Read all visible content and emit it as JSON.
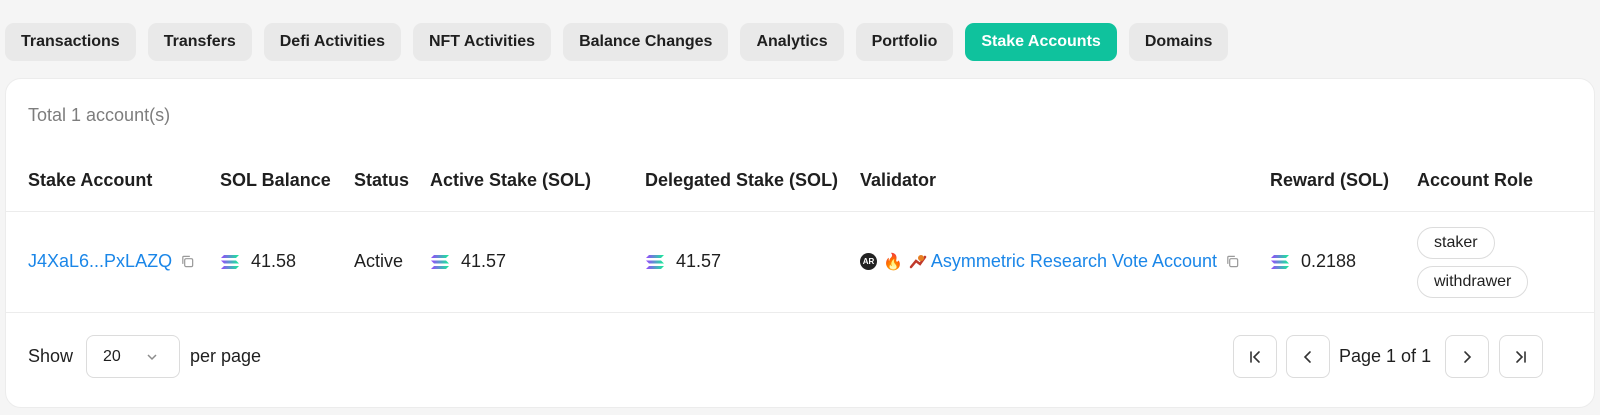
{
  "tabs": [
    {
      "label": "Transactions",
      "active": false
    },
    {
      "label": "Transfers",
      "active": false
    },
    {
      "label": "Defi Activities",
      "active": false
    },
    {
      "label": "NFT Activities",
      "active": false
    },
    {
      "label": "Balance Changes",
      "active": false
    },
    {
      "label": "Analytics",
      "active": false
    },
    {
      "label": "Portfolio",
      "active": false
    },
    {
      "label": "Stake Accounts",
      "active": true
    },
    {
      "label": "Domains",
      "active": false
    }
  ],
  "summary": {
    "total_text": "Total 1 account(s)"
  },
  "table": {
    "headers": {
      "stake_account": "Stake Account",
      "sol_balance": "SOL Balance",
      "status": "Status",
      "active_stake": "Active Stake (SOL)",
      "delegated_stake": "Delegated Stake (SOL)",
      "validator": "Validator",
      "reward": "Reward (SOL)",
      "account_role": "Account Role"
    },
    "rows": [
      {
        "stake_account": "J4XaL6...PxLAZQ",
        "sol_balance": "41.58",
        "status": "Active",
        "active_stake": "41.57",
        "delegated_stake": "41.57",
        "validator_logo": "AR",
        "validator_name": "Asymmetric Research Vote Account",
        "reward": "0.2188",
        "roles": [
          "staker",
          "withdrawer"
        ]
      }
    ]
  },
  "pagination": {
    "show_label": "Show",
    "per_page_value": "20",
    "per_page_label": "per page",
    "page_info": "Page 1 of 1"
  },
  "colors": {
    "accent": "#0fc29d",
    "link": "#1a86e8"
  },
  "icons": [
    "copy-icon",
    "solana-icon",
    "fire-icon",
    "chevron-down-icon",
    "first-page-icon",
    "prev-page-icon",
    "next-page-icon",
    "last-page-icon"
  ]
}
